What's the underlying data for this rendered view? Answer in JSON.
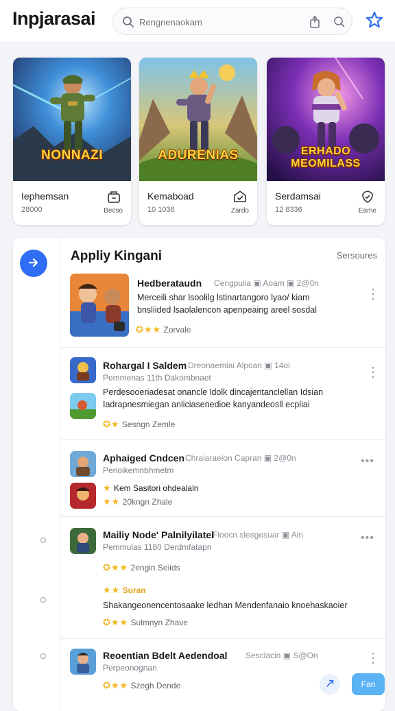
{
  "app": {
    "title": "Inpjarasai"
  },
  "search": {
    "placeholder": "Rengnenaokam"
  },
  "featured": [
    {
      "name": "Iephemsan",
      "sub": "28000",
      "logo": "NONNAZI",
      "action": "Becso"
    },
    {
      "name": "Kemaboad",
      "sub": "10 1036",
      "logo": "ADURENIAS",
      "action": "Zardo"
    },
    {
      "name": "Serdamsai",
      "sub": "12 8336",
      "logo": "ERHADO MEOMILASS",
      "action": "Eame"
    }
  ],
  "list": {
    "title": "Appliy Kingani",
    "link": "Sersoures",
    "items": [
      {
        "title": "Hedberataudn",
        "meta": "Cengpuiia ▣ Aoam ▣ 2@0n",
        "desc1": "Merceili shar lsoolilg lstinartangoro lyao/ kiam",
        "desc2": "bnsliided lsaolalencon apenpeaing areel sosdal",
        "rating": "Zorvale"
      },
      {
        "title": "Rohargal I Saldem",
        "meta": "Dreonaemiai Alpoan ▣ 14oi",
        "sub": "Pemmenas 11th Dakombnaet",
        "desc1": "Perdesooeriadesat onancle ldolk dincajentanclellan Idsian",
        "desc2": "Iadrapnesmiegan anliciasenedioe kanyandeosll ecpliai",
        "rating": "Sesngn   Zemle"
      },
      {
        "title": "Aphaiged Cndcen",
        "meta": "Chraiaraeion Capran ▣ 2@0n",
        "sub": "Perioikemnbhmetm",
        "extra": "Kem Sasitori ohdealaln",
        "rating": "20kngn   Zhale"
      },
      {
        "title": "Mailiy Node' Palnilyilatel",
        "meta": "Floocn slesgesuar ▣ Ain",
        "sub": "Pemmulas 1180 Derdmfatapn",
        "rating": "2engin   Seiids",
        "highlight": "Suran",
        "desc1": "Shakangeonencentosaake ledhan Mendenfanaio knoehaskaoier",
        "rating2": "Sulmnyn   Zhave"
      },
      {
        "title": "Reoentian Bdelt Aedendoal",
        "meta": "Sesclacin ▣ S@On",
        "sub": "Perpeonognan",
        "rating": "Szegh   Dende"
      }
    ]
  },
  "fab": {
    "label": "Fan"
  },
  "colors": {
    "accent": "#2f6df5",
    "star": "#f2b61f"
  }
}
